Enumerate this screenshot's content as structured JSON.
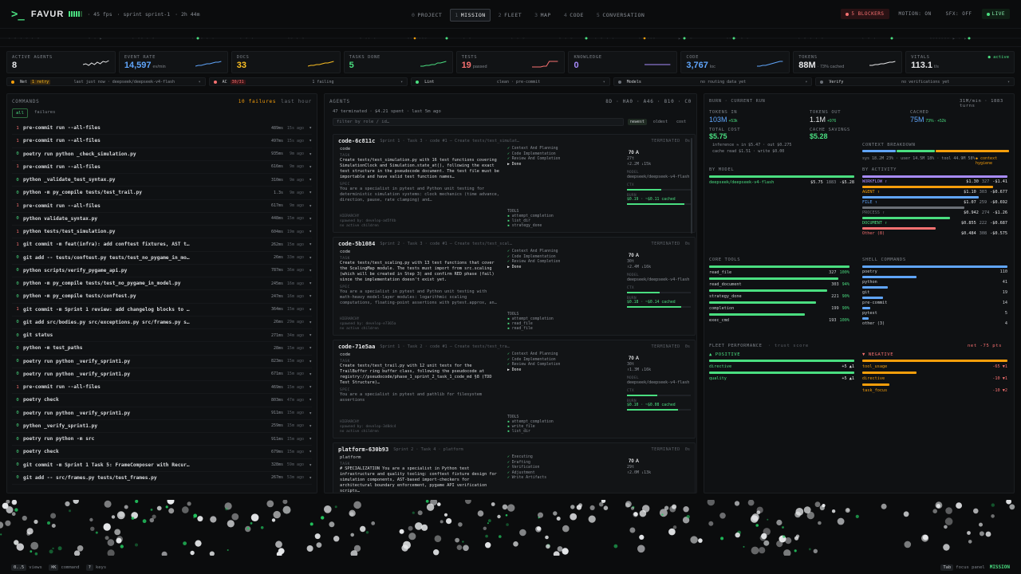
{
  "top": {
    "logo_icon": ">_",
    "brand": "FAVUR",
    "fps": "· 45 fps",
    "sprint": "· sprint sprint-1",
    "elapsed": "· 2h 44m"
  },
  "nav": [
    {
      "k": "0",
      "l": "PROJECT"
    },
    {
      "k": "1",
      "l": "MISSION",
      "active": true
    },
    {
      "k": "2",
      "l": "FLEET"
    },
    {
      "k": "3",
      "l": "MAP"
    },
    {
      "k": "4",
      "l": "CODE"
    },
    {
      "k": "5",
      "l": "CONVERSATION"
    }
  ],
  "right": {
    "blockers": "5 BLOCKERS",
    "motion": "MOTION: ON",
    "sfx": "SFX: OFF",
    "live": "LIVE"
  },
  "kpis": [
    {
      "label": "ACTIVE AGENTS",
      "value": "8",
      "unit": "",
      "color": "#e6e7e9"
    },
    {
      "label": "EVENT RATE",
      "value": "14,597",
      "unit": "ev/min",
      "color": "#60a5fa"
    },
    {
      "label": "DOCS",
      "value": "33",
      "unit": "",
      "color": "#fbbf24"
    },
    {
      "label": "TASKS DONE",
      "value": "5",
      "unit": "",
      "color": "#4ade80"
    },
    {
      "label": "TESTS",
      "value": "19",
      "unit": "passed",
      "color": "#f87171"
    },
    {
      "label": "KNOWLEDGE",
      "value": "0",
      "unit": "",
      "color": "#a78bfa"
    },
    {
      "label": "CODE",
      "value": "3,767",
      "unit": "loc",
      "color": "#60a5fa"
    },
    {
      "label": "TOKENS",
      "value": "88M",
      "unit": "· 73% cached",
      "color": "#e6e7e9"
    },
    {
      "label": "VITALS",
      "value": "113.1",
      "unit": "t/s",
      "color": "#e6e7e9",
      "live": "● active"
    }
  ],
  "status": [
    {
      "name": "Net",
      "tag": "1 retry",
      "mid": "last just now · deepseek/deepseek-v4-flash",
      "dot": "#f59e0b"
    },
    {
      "name": "AC",
      "tag": "30/31",
      "mid": "1 failing",
      "dot": "#f87171",
      "red": true
    },
    {
      "name": "Lint",
      "tag": "",
      "mid": "clean · pre-commit",
      "dot": "#4ade80"
    },
    {
      "name": "Models",
      "tag": "",
      "mid": "no routing data yet",
      "dot": "#6b7077"
    },
    {
      "name": "Verify",
      "tag": "",
      "mid": "no verifications yet",
      "dot": "#6b7077"
    }
  ],
  "commands": {
    "title": "COMMANDS",
    "failures": "10 failures",
    "window": "last hour",
    "filter_all": "all",
    "filter_fail": "failures",
    "rows": [
      {
        "ec": "1",
        "ok": false,
        "cmd": "pre-commit run --all-files",
        "dur": "489ms",
        "ago": "15s ago"
      },
      {
        "ec": "1",
        "ok": false,
        "cmd": "pre-commit run --all-files",
        "dur": "497ms",
        "ago": "15s ago"
      },
      {
        "ec": "0",
        "ok": true,
        "cmd": "poetry run python _check_simulation.py",
        "dur": "935ms",
        "ago": "9m ago"
      },
      {
        "ec": "1",
        "ok": false,
        "cmd": "pre-commit run --all-files",
        "dur": "616ms",
        "ago": "9m ago"
      },
      {
        "ec": "0",
        "ok": true,
        "cmd": "python _validate_test_syntax.py",
        "dur": "310ms",
        "ago": "9m ago"
      },
      {
        "ec": "0",
        "ok": true,
        "cmd": "python -m py_compile tests/test_trail.py",
        "dur": "1.3s",
        "ago": "9m ago"
      },
      {
        "ec": "1",
        "ok": false,
        "cmd": "pre-commit run --all-files",
        "dur": "617ms",
        "ago": "9m ago"
      },
      {
        "ec": "0",
        "ok": true,
        "cmd": "python validate_syntax.py",
        "dur": "448ms",
        "ago": "15m ago"
      },
      {
        "ec": "1",
        "ok": false,
        "cmd": "python tests/test_simulation.py",
        "dur": "604ms",
        "ago": "19m ago"
      },
      {
        "ec": "1",
        "ok": false,
        "cmd": "git commit -m feat(infra): add conftest fixtures, AST t…",
        "dur": "262ms",
        "ago": "15m ago"
      },
      {
        "ec": "0",
        "ok": true,
        "cmd": "git add -- tests/conftest.py tests/test_no_pygame_in_mo…",
        "dur": "26ms",
        "ago": "33m ago"
      },
      {
        "ec": "0",
        "ok": true,
        "cmd": "python scripts/verify_pygame_api.py",
        "dur": "787ms",
        "ago": "36m ago"
      },
      {
        "ec": "0",
        "ok": true,
        "cmd": "python -m py_compile tests/test_no_pygame_in_model.py",
        "dur": "245ms",
        "ago": "16m ago"
      },
      {
        "ec": "0",
        "ok": true,
        "cmd": "python -m py_compile tests/conftest.py",
        "dur": "247ms",
        "ago": "16m ago"
      },
      {
        "ec": "1",
        "ok": false,
        "cmd": "git commit -m Sprint 1 review: add changelog blocks to …",
        "dur": "364ms",
        "ago": "15m ago"
      },
      {
        "ec": "0",
        "ok": true,
        "cmd": "git add src/bodies.py src/exceptions.py src/frames.py s…",
        "dur": "26ms",
        "ago": "29m ago"
      },
      {
        "ec": "0",
        "ok": true,
        "cmd": "git status",
        "dur": "271ms",
        "ago": "34m ago"
      },
      {
        "ec": "0",
        "ok": true,
        "cmd": "python -m test_paths",
        "dur": "28ms",
        "ago": "15m ago"
      },
      {
        "ec": "0",
        "ok": true,
        "cmd": "poetry run python _verify_sprint1.py",
        "dur": "823ms",
        "ago": "15m ago"
      },
      {
        "ec": "0",
        "ok": true,
        "cmd": "poetry run python _verify_sprint1.py",
        "dur": "671ms",
        "ago": "15m ago"
      },
      {
        "ec": "1",
        "ok": false,
        "cmd": "pre-commit run --all-files",
        "dur": "469ms",
        "ago": "15m ago"
      },
      {
        "ec": "0",
        "ok": true,
        "cmd": "poetry check",
        "dur": "803ms",
        "ago": "47m ago"
      },
      {
        "ec": "0",
        "ok": true,
        "cmd": "poetry run python _verify_sprint1.py",
        "dur": "911ms",
        "ago": "15m ago"
      },
      {
        "ec": "0",
        "ok": true,
        "cmd": "python _verify_sprint1.py",
        "dur": "259ms",
        "ago": "15m ago"
      },
      {
        "ec": "0",
        "ok": true,
        "cmd": "poetry run python -m src",
        "dur": "911ms",
        "ago": "15m ago"
      },
      {
        "ec": "0",
        "ok": true,
        "cmd": "poetry check",
        "dur": "679ms",
        "ago": "15m ago"
      },
      {
        "ec": "0",
        "ok": true,
        "cmd": "git commit -m Sprint 1 Task 5: FrameComposer with Recur…",
        "dur": "328ms",
        "ago": "59m ago"
      },
      {
        "ec": "0",
        "ok": true,
        "cmd": "git add -- src/frames.py tests/test_frames.py",
        "dur": "267ms",
        "ago": "53m ago"
      }
    ]
  },
  "agents": {
    "title": "AGENTS",
    "counts": "8D · HA0 · A46 · 810 · C0",
    "summary": "47 terminated · $4.21 spent · last 5m ago",
    "filter_ph": "filter by role / id…",
    "sort": [
      "newest",
      "oldest",
      "cost"
    ],
    "cards": [
      {
        "id": "code-6c811c",
        "meta": "Sprint 1 · Task 3 · code #1 — Create tests/test_simulat…",
        "role": "code",
        "task": "Create tests/test_simulation.py with 16 test functions covering SimulationClock and Simulation.state_at(), following the exact test structure in the pseudocode document. The test file must be importable and have valid test function names…",
        "spec": "You are a specialist in pytest and Python unit testing for deterministic simulation systems: clock mechanics (time advance, direction, pause, rate clamping) and…",
        "phases": [
          "Context And Planning",
          "Code Implementation",
          "Review And Completion"
        ],
        "done": "Done",
        "model": "deepseek/deepseek-v4-flash",
        "tools": [
          "attempt_completion",
          "list_dir",
          "strategy_done"
        ],
        "parent": "spawned by: develop-ad5f4b",
        "children": "no active children",
        "score": "70",
        "turns": "27t",
        "tok": "↑2.2M ↓15k",
        "cached": "$0.19 · ~$0.11 cached",
        "pct": 0.9
      },
      {
        "id": "code-5b1084",
        "meta": "Sprint 2 · Task 3 · code #1 — Create tests/test_scal…",
        "role": "code",
        "task": "Create tests/test_scaling.py with 13 test functions that cover the ScalingMap module. The tests must import from src.scaling (which will be created in Step 3) and confirm RED phase (fail) since the implementation doesn't exist yet.",
        "spec": "You are a specialist in pytest and Python unit testing with math-heavy model-layer modules: logarithmic scaling computations, floating-point assertions with pytest.approx, an…",
        "phases": [
          "Context And Planning",
          "Code Implementation",
          "Review And Completion"
        ],
        "done": "Done",
        "model": "deepseek/deepseek-v4-flash",
        "tools": [
          "attempt_completion",
          "read_file",
          "read_file"
        ],
        "parent": "spawned by: develop-e7365a",
        "children": "no active children",
        "score": "70",
        "turns": "30t",
        "tok": "↑2.4M ↓16k",
        "cached": "$0.18 · ~$0.14 cached",
        "pct": 0.85
      },
      {
        "id": "code-71e5aa",
        "meta": "Sprint 1 · Task 2 · code #1 — Create tests/test_tra…",
        "role": "code",
        "task": "Create tests/test_trail.py with 12 unit tests for the TrailBuffer ring buffer class, following the pseudocode at registry://pseudocode/phase_1_sprint_2_task_1_code_md §8 (TDD Test Structure)…",
        "spec": "You are a specialist in pytest and pathlib for filesystem assertions",
        "phases": [
          "Context And Planning",
          "Code Implementation",
          "Review And Completion"
        ],
        "done": "Done",
        "model": "deepseek/deepseek-v4-flash",
        "tools": [
          "attempt_completion",
          "write_file",
          "list_dir"
        ],
        "parent": "spawned by: develop-3d8dc4",
        "children": "no active children",
        "score": "70",
        "turns": "30t",
        "tok": "↑1.3M ↓16k",
        "cached": "$0.10 · ~$0.08 cached",
        "pct": 0.8
      },
      {
        "id": "platform-630b93",
        "meta": "Sprint 2 · Task 4 · platform",
        "role": "platform",
        "task": "# SPECIALIZATION You are a specialist in Python test infrastructure and quality tooling: conftest fixture design for simulation components, AST-based import-checkers for architectural boundary enforcement, pygame API verification scripts…",
        "spec": "",
        "phases": [
          "Executing",
          "Drafting",
          "Verification",
          "Adjustment",
          "Write Artifacts"
        ],
        "done": "",
        "model": "",
        "tools": [],
        "parent": "",
        "children": "",
        "score": "70",
        "turns": "29t",
        "tok": "↑2.0M ↓13k",
        "cached": "",
        "pct": 0.6
      }
    ],
    "terminated": "TERMINATED",
    "score_suffix": "A"
  },
  "burn": {
    "title": "BURN · CURRENT RUN",
    "rate": "31M/min · 1883 turns",
    "tokens_in": {
      "l": "TOKENS IN",
      "v": "103M",
      "d": "+53k"
    },
    "tokens_out": {
      "l": "TOKENS OUT",
      "v": "1.1M",
      "d": "+976"
    },
    "cached": {
      "l": "CACHED",
      "v": "75M",
      "d": "73% · +52k"
    },
    "total_cost": {
      "l": "TOTAL COST",
      "v": "$5.75"
    },
    "inference": "inference ≈ in $5.47  · out $0.275",
    "cache_line": "cache  read $1.51  · write $0.00",
    "savings": {
      "l": "CACHE SAVINGS",
      "v": "$5.28"
    },
    "ctx": {
      "l": "CONTEXT BREAKDOWN",
      "legend": "sys 18.2M 23% · user 14.5M 18% · tool 44.9M 58%",
      "hyg": "◆ context hygiene"
    },
    "by_model": {
      "l": "BY MODEL",
      "rows": [
        {
          "n": "deepseek/deepseek-v4-flash",
          "c": "$5.75",
          "t": "1883",
          "d": "-$5.28"
        }
      ]
    },
    "by_activity": {
      "l": "BY ACTIVITY",
      "rows": [
        {
          "n": "WORKFLOW ↑",
          "c": "$1.30",
          "t": "327",
          "d": "-$1.41",
          "col": "#a78bfa"
        },
        {
          "n": "AGENT ↑",
          "c": "$1.10",
          "t": "303",
          "d": "-$0.677",
          "col": "#f59e0b"
        },
        {
          "n": "FILE ↑",
          "c": "$1.07",
          "t": "259",
          "d": "-$0.692",
          "col": "#60a5fa"
        },
        {
          "n": "PROCESS ↑",
          "c": "$0.942",
          "t": "274",
          "d": "-$1.26",
          "col": "#6b7077"
        },
        {
          "n": "DOCUMENT ↑",
          "c": "$0.855",
          "t": "222",
          "d": "-$0.687",
          "col": "#4ade80"
        },
        {
          "n": "Other (8)",
          "c": "$0.484",
          "t": "308",
          "d": "-$0.575",
          "col": "#f87171"
        }
      ]
    },
    "core_tools": {
      "l": "CORE TOOLS",
      "rows": [
        {
          "n": "read_file",
          "v": "327",
          "p": "100%"
        },
        {
          "n": "read_document",
          "v": "303",
          "p": "94%"
        },
        {
          "n": "strategy_done",
          "v": "221",
          "p": "90%"
        },
        {
          "n": "completion",
          "v": "199",
          "p": "90%"
        },
        {
          "n": "exec_cmd",
          "v": "193",
          "p": "100%"
        }
      ]
    },
    "shell": {
      "l": "SHELL COMMANDS",
      "rows": [
        {
          "n": "poetry",
          "v": "110"
        },
        {
          "n": "python",
          "v": "41"
        },
        {
          "n": "git",
          "v": "19"
        },
        {
          "n": "pre-commit",
          "v": "14"
        },
        {
          "n": "pytest",
          "v": "5"
        },
        {
          "n": "other (3)",
          "v": "4"
        }
      ]
    },
    "fleet": {
      "l": "FLEET PERFORMANCE",
      "sub": "· trust score",
      "net": "net -75 pts",
      "pos": {
        "l": "▲ POSITIVE",
        "rows": [
          {
            "n": "directive",
            "v": "+5 ▲1"
          },
          {
            "n": "quality",
            "v": "+5 ▲1"
          }
        ]
      },
      "neg": {
        "l": "▼ NEGATIVE",
        "rows": [
          {
            "n": "tool_usage",
            "v": "-65 ▼1"
          },
          {
            "n": "directive",
            "v": "-10 ▼1"
          },
          {
            "n": "task_focus",
            "v": "-10 ▼2"
          }
        ]
      }
    }
  },
  "footer": {
    "views_k": "0..5",
    "views": "views",
    "cmd_k": "⌘K",
    "cmd": "command",
    "keys_k": "?",
    "keys": "keys",
    "tab_k": "Tab",
    "tab": "focus panel",
    "mode": "MISSION"
  }
}
